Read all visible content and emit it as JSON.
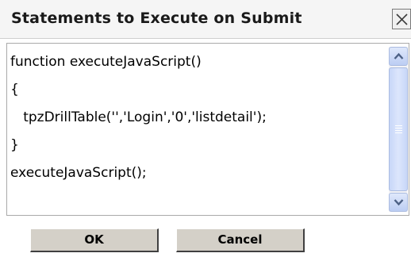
{
  "dialog": {
    "title": "Statements to Execute on Submit",
    "close_icon": "close-icon"
  },
  "editor": {
    "lines": [
      "function executeJavaScript()",
      "{",
      "   tpzDrillTable('','Login','0','listdetail');",
      "}",
      "executeJavaScript();"
    ]
  },
  "scrollbar": {
    "up_icon": "chevron-up-icon",
    "down_icon": "chevron-down-icon"
  },
  "buttons": {
    "ok_label": "OK",
    "cancel_label": "Cancel"
  },
  "colors": {
    "titlebar_bg": "#f5f5f5",
    "button_face": "#d4d0c8",
    "scroll_accent": "#bccdf3",
    "scroll_arrow": "#4d6185"
  }
}
